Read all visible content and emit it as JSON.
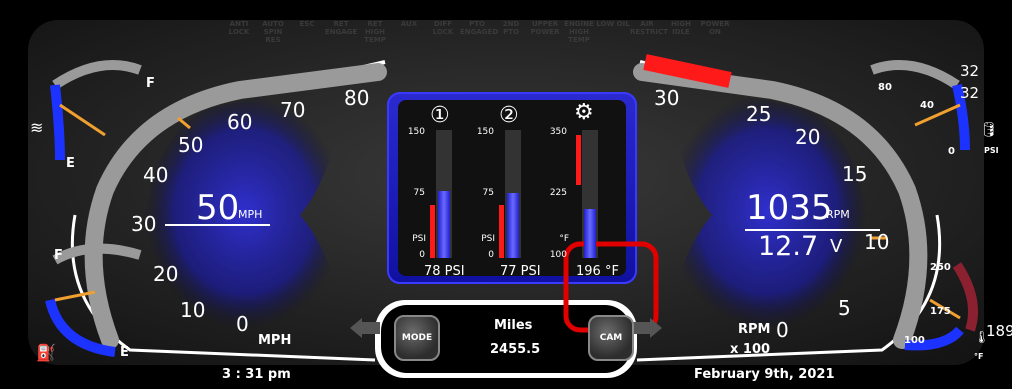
{
  "warnings": [
    {
      "id": "anti-lock",
      "label": "ANTI LOCK"
    },
    {
      "id": "auto-spin",
      "label": "AUTO SPIN RES"
    },
    {
      "id": "esc",
      "label": "ESC"
    },
    {
      "id": "ret-engage",
      "label": "RET ENGAGE"
    },
    {
      "id": "ret-high-temp",
      "label": "RET HIGH TEMP"
    },
    {
      "id": "aux",
      "label": "AUX"
    },
    {
      "id": "diff-lock",
      "label": "DIFF LOCK"
    },
    {
      "id": "pto-engaged",
      "label": "PTO ENGAGED"
    },
    {
      "id": "2nd-pto",
      "label": "2ND PTO"
    },
    {
      "id": "upper-power",
      "label": "UPPER POWER"
    },
    {
      "id": "engine-high-temp",
      "label": "ENGINE HIGH TEMP"
    },
    {
      "id": "low-oil",
      "label": "LOW OIL"
    },
    {
      "id": "air-restrict",
      "label": "AIR RESTRICT"
    },
    {
      "id": "high-idle",
      "label": "HIGH IDLE"
    },
    {
      "id": "power-on",
      "label": "POWER ON"
    }
  ],
  "speedometer": {
    "value": "50",
    "unit": "MPH",
    "unit_label": "MPH",
    "ticks": [
      "0",
      "10",
      "20",
      "30",
      "40",
      "50",
      "60",
      "70",
      "80"
    ]
  },
  "tachometer": {
    "rpm": "1035",
    "rpm_unit": "RPM",
    "volts": "12.7",
    "volts_unit": "V",
    "unit_label": "RPM",
    "multiplier": "x 100",
    "ticks": [
      "0",
      "5",
      "10",
      "15",
      "20",
      "25",
      "30"
    ]
  },
  "fuel_gauge": {
    "full": "F",
    "empty": "E"
  },
  "def_gauge": {
    "full": "F",
    "empty": "E"
  },
  "oil_pressure": {
    "top": "80",
    "mid": "40",
    "bottom": "0",
    "unit": "PSI",
    "value_top": "32",
    "value": "32"
  },
  "coolant_temp": {
    "top": "250",
    "mid": "175",
    "bottom": "100",
    "unit": "°F",
    "value": "189"
  },
  "center_panel": {
    "bars": [
      {
        "icon": "①",
        "scale": [
          "150",
          "75",
          "0"
        ],
        "unit": "PSI",
        "readout": "78 PSI",
        "level": 0.52
      },
      {
        "icon": "②",
        "scale": [
          "150",
          "75",
          "0"
        ],
        "unit": "PSI",
        "readout": "77 PSI",
        "level": 0.51
      },
      {
        "icon": "gear-thermometer",
        "scale": [
          "350",
          "225",
          "100"
        ],
        "unit": "°F",
        "readout": "196 °F",
        "level": 0.38
      }
    ]
  },
  "odometer": {
    "label": "Miles",
    "value": "2455.5",
    "mode_button": "MODE",
    "cam_button": "CAM"
  },
  "footer": {
    "time": "3 : 31 pm",
    "date": "February 9th, 2021"
  },
  "colors": {
    "accent_blue": "#1c32ff",
    "glow_blue": "#2a2ad0",
    "warning_red": "#ff1a1a",
    "highlight_box": "#e00000",
    "needle": "#f0a030"
  }
}
